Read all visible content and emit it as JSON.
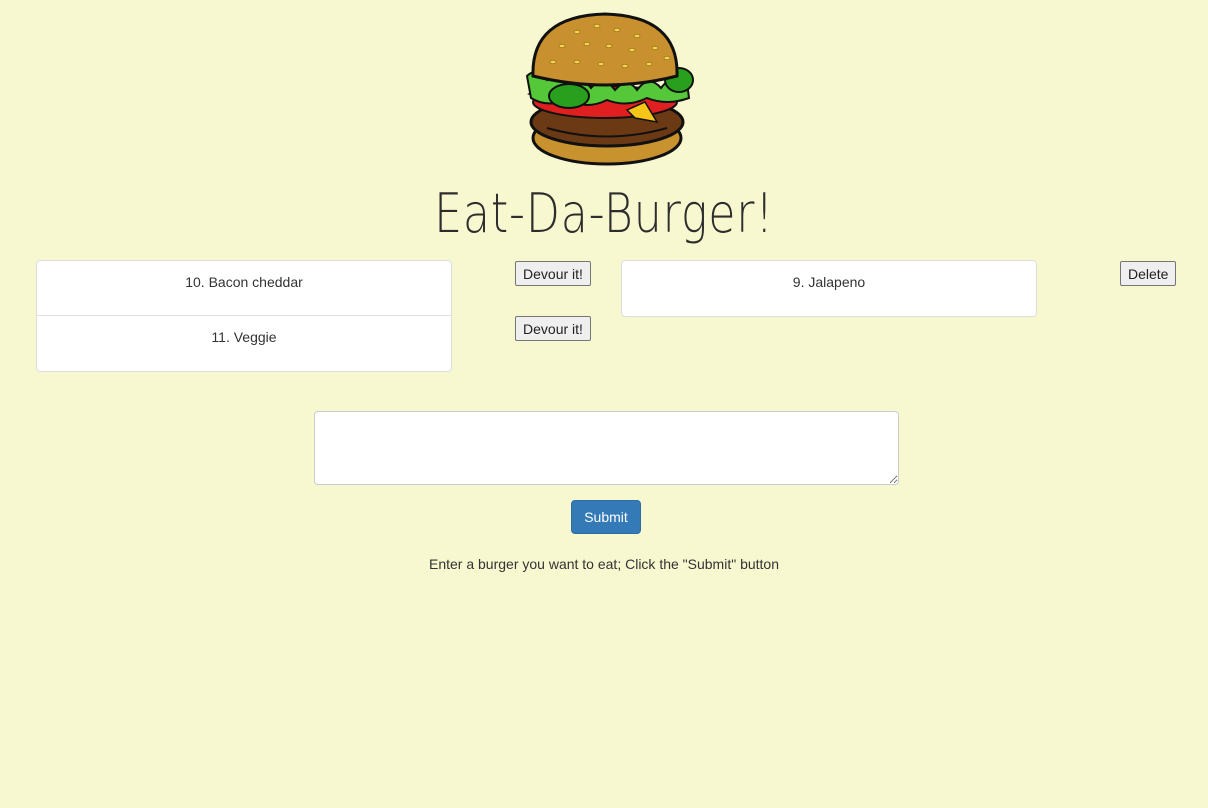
{
  "header": {
    "title": "Eat-Da-Burger!",
    "logo_icon": "burger-icon"
  },
  "uneaten": {
    "items": [
      {
        "label": "10. Bacon cheddar",
        "button": "Devour it!"
      },
      {
        "label": "11. Veggie",
        "button": "Devour it!"
      }
    ]
  },
  "devoured": {
    "items": [
      {
        "label": "9. Jalapeno",
        "button": "Delete"
      }
    ]
  },
  "form": {
    "textarea_value": "",
    "submit_label": "Submit",
    "instructions": "Enter a burger you want to eat; Click the \"Submit\" button"
  },
  "colors": {
    "background": "#f8f8d0",
    "submit_button": "#337ab7"
  }
}
